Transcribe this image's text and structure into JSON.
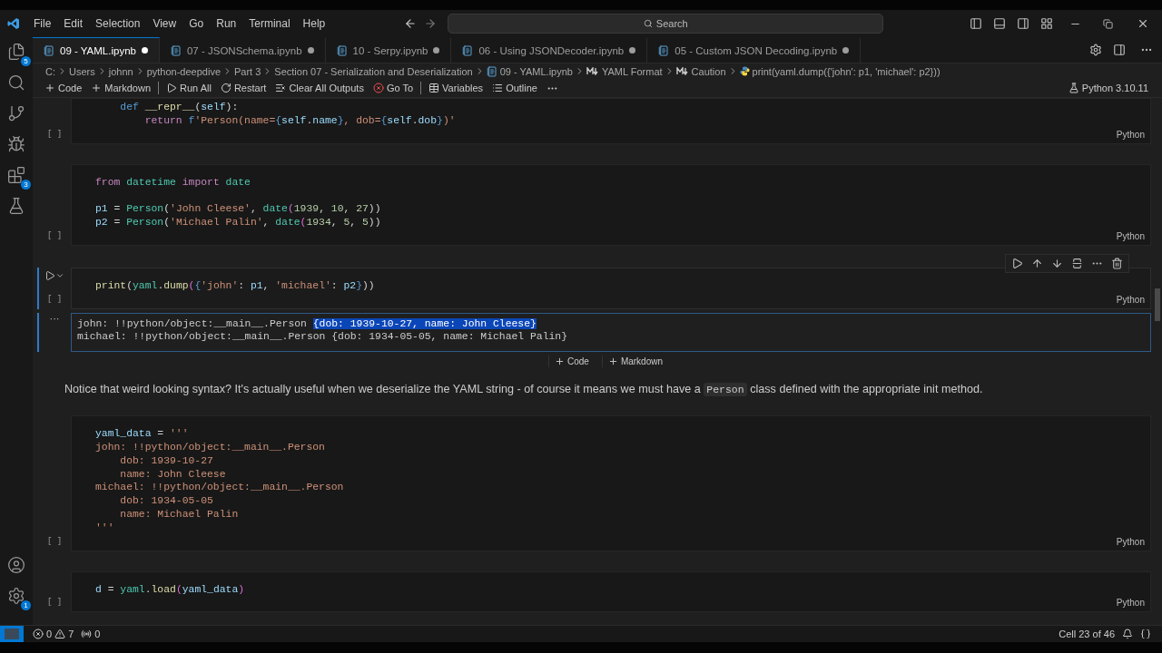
{
  "menu": [
    "File",
    "Edit",
    "Selection",
    "View",
    "Go",
    "Run",
    "Terminal",
    "Help"
  ],
  "search": {
    "placeholder": "Search"
  },
  "activity_bar": [
    {
      "kind": "files",
      "badge": "5",
      "selected": false
    },
    {
      "kind": "search",
      "selected": false
    },
    {
      "kind": "source-control",
      "selected": false
    },
    {
      "kind": "run-debug",
      "selected": false
    },
    {
      "kind": "extensions",
      "badge": "3",
      "selected": false
    },
    {
      "kind": "testing",
      "selected": false
    }
  ],
  "activity_bar_bottom": [
    {
      "kind": "account"
    },
    {
      "kind": "settings",
      "badge": "1"
    }
  ],
  "tabs": [
    {
      "label": "09 - YAML.ipynb",
      "selected": true,
      "dirty": true
    },
    {
      "label": "07 - JSONSchema.ipynb",
      "selected": false,
      "dirty": true
    },
    {
      "label": "10 - Serpy.ipynb",
      "selected": false,
      "dirty": true
    },
    {
      "label": "06 - Using JSONDecoder.ipynb",
      "selected": false,
      "dirty": true
    },
    {
      "label": "05 - Custom JSON Decoding.ipynb",
      "selected": false,
      "dirty": true
    }
  ],
  "breadcrumb": [
    {
      "kind": "folder",
      "label": "C:"
    },
    {
      "kind": "folder",
      "label": "Users"
    },
    {
      "kind": "folder",
      "label": "johnn"
    },
    {
      "kind": "folder",
      "label": "python-deepdive"
    },
    {
      "kind": "folder",
      "label": "Part 3"
    },
    {
      "kind": "folder",
      "label": "Section 07 - Serialization and Deserialization"
    },
    {
      "kind": "notebook",
      "label": "09 - YAML.ipynb"
    },
    {
      "kind": "markdown",
      "label": "YAML Format"
    },
    {
      "kind": "markdown",
      "label": "Caution"
    },
    {
      "kind": "code",
      "label": "print(yaml.dump({'john': p1, 'michael': p2}))"
    }
  ],
  "toolbar": [
    {
      "kind": "add",
      "label": "Code"
    },
    {
      "kind": "add",
      "label": "Markdown"
    },
    {
      "kind": "separator"
    },
    {
      "kind": "run-all",
      "label": "Run All"
    },
    {
      "kind": "restart",
      "label": "Restart"
    },
    {
      "kind": "clear",
      "label": "Clear All Outputs"
    },
    {
      "kind": "goto",
      "label": "Go To"
    },
    {
      "kind": "separator"
    },
    {
      "kind": "variables",
      "label": "Variables"
    },
    {
      "kind": "outline",
      "label": "Outline"
    },
    {
      "kind": "more"
    }
  ],
  "kernel": "Python 3.10.11",
  "cells": [
    {
      "kind": "code",
      "selected": false,
      "exec": "[ ]",
      "language": "Python",
      "lines": [
        {
          "tokens": [
            {
              "text": "    def ",
              "kind": "kw"
            },
            {
              "text": "__repr__",
              "kind": "fn"
            },
            {
              "text": "(",
              "kind": "p"
            },
            {
              "text": "self",
              "kind": "var"
            },
            {
              "text": "):",
              "kind": "p"
            }
          ]
        },
        {
          "tokens": [
            {
              "text": "        return ",
              "kind": "ctl"
            },
            {
              "text": "f",
              "kind": "kw"
            },
            {
              "text": "'Person(name=",
              "kind": "str"
            },
            {
              "text": "{",
              "kind": "kw"
            },
            {
              "text": "self",
              "kind": "var"
            },
            {
              "text": ".",
              "kind": "p"
            },
            {
              "text": "name",
              "kind": "var"
            },
            {
              "text": "}",
              "kind": "kw"
            },
            {
              "text": ", dob=",
              "kind": "str"
            },
            {
              "text": "{",
              "kind": "kw"
            },
            {
              "text": "self",
              "kind": "var"
            },
            {
              "text": ".",
              "kind": "p"
            },
            {
              "text": "dob",
              "kind": "var"
            },
            {
              "text": "}",
              "kind": "kw"
            },
            {
              "text": ")'",
              "kind": "str"
            }
          ]
        }
      ]
    },
    {
      "kind": "code",
      "selected": false,
      "exec": "[ ]",
      "language": "Python",
      "lines": [
        {
          "tokens": [
            {
              "text": "from ",
              "kind": "ctl"
            },
            {
              "text": "datetime ",
              "kind": "cls"
            },
            {
              "text": "import ",
              "kind": "ctl"
            },
            {
              "text": "date",
              "kind": "cls"
            }
          ]
        },
        {
          "blank_before": true,
          "tokens": [
            {
              "text": "p1 ",
              "kind": "var"
            },
            {
              "text": "= ",
              "kind": "p"
            },
            {
              "text": "Person",
              "kind": "cls"
            },
            {
              "text": "(",
              "kind": "p"
            },
            {
              "text": "'John Cleese'",
              "kind": "str"
            },
            {
              "text": ", ",
              "kind": "p"
            },
            {
              "text": "date",
              "kind": "cls"
            },
            {
              "text": "(",
              "kind": "br"
            },
            {
              "text": "1939",
              "kind": "num"
            },
            {
              "text": ", ",
              "kind": "p"
            },
            {
              "text": "10",
              "kind": "num"
            },
            {
              "text": ", ",
              "kind": "p"
            },
            {
              "text": "27",
              "kind": "num"
            },
            {
              "text": "))",
              "kind": "p"
            }
          ]
        },
        {
          "tokens": [
            {
              "text": "p2 ",
              "kind": "var"
            },
            {
              "text": "= ",
              "kind": "p"
            },
            {
              "text": "Person",
              "kind": "cls"
            },
            {
              "text": "(",
              "kind": "p"
            },
            {
              "text": "'Michael Palin'",
              "kind": "str"
            },
            {
              "text": ", ",
              "kind": "p"
            },
            {
              "text": "date",
              "kind": "cls"
            },
            {
              "text": "(",
              "kind": "br"
            },
            {
              "text": "1934",
              "kind": "num"
            },
            {
              "text": ", ",
              "kind": "p"
            },
            {
              "text": "5",
              "kind": "num"
            },
            {
              "text": ", ",
              "kind": "p"
            },
            {
              "text": "5",
              "kind": "num"
            },
            {
              "text": "))",
              "kind": "p"
            }
          ]
        }
      ]
    },
    {
      "kind": "code",
      "selected": true,
      "exec": "[ ]",
      "language": "Python",
      "lines": [
        {
          "tokens": [
            {
              "text": "print",
              "kind": "fn"
            },
            {
              "text": "(",
              "kind": "p"
            },
            {
              "text": "yaml",
              "kind": "cls"
            },
            {
              "text": ".",
              "kind": "p"
            },
            {
              "text": "dump",
              "kind": "fn"
            },
            {
              "text": "(",
              "kind": "br"
            },
            {
              "text": "{",
              "kind": "kw"
            },
            {
              "text": "'john'",
              "kind": "str"
            },
            {
              "text": ": ",
              "kind": "p"
            },
            {
              "text": "p1",
              "kind": "var"
            },
            {
              "text": ", ",
              "kind": "p"
            },
            {
              "text": "'michael'",
              "kind": "str"
            },
            {
              "text": ": ",
              "kind": "p"
            },
            {
              "text": "p2",
              "kind": "var"
            },
            {
              "text": "}",
              "kind": "kw"
            },
            {
              "text": "))",
              "kind": "p"
            }
          ]
        }
      ],
      "output": {
        "marker": "···",
        "lines": [
          [
            {
              "text": "john: !!python/object:__main__.Person ",
              "selected": false
            },
            {
              "text": "{dob: 1939-10-27, name: John Cleese}",
              "selected": true
            }
          ],
          [
            {
              "text": "michael: !!python/object:__main__.Person {dob: 1934-05-05, name: Michael Palin}",
              "selected": false
            }
          ]
        ]
      }
    },
    {
      "kind": "insert",
      "buttons": [
        "Code",
        "Markdown"
      ]
    },
    {
      "kind": "markdown",
      "segments": [
        {
          "kind": "text",
          "text": "Notice that weird looking syntax? It's actually useful when we deserialize the YAML string - of course it means we must have a "
        },
        {
          "kind": "code",
          "text": "Person"
        },
        {
          "kind": "text",
          "text": " class defined with the appropriate init method."
        }
      ]
    },
    {
      "kind": "code",
      "selected": false,
      "exec": "[ ]",
      "language": "Python",
      "lines": [
        {
          "tokens": [
            {
              "text": "yaml_data ",
              "kind": "var"
            },
            {
              "text": "= ",
              "kind": "p"
            },
            {
              "text": "'''",
              "kind": "str"
            }
          ]
        },
        {
          "tokens": [
            {
              "text": "john: !!python/object:__main__.Person",
              "kind": "str"
            }
          ]
        },
        {
          "tokens": [
            {
              "text": "    dob: 1939-10-27",
              "kind": "str"
            }
          ]
        },
        {
          "tokens": [
            {
              "text": "    name: John Cleese",
              "kind": "str"
            }
          ]
        },
        {
          "tokens": [
            {
              "text": "michael: !!python/object:__main__.Person",
              "kind": "str"
            }
          ]
        },
        {
          "tokens": [
            {
              "text": "    dob: 1934-05-05",
              "kind": "str"
            }
          ]
        },
        {
          "tokens": [
            {
              "text": "    name: Michael Palin",
              "kind": "str"
            }
          ]
        },
        {
          "tokens": [
            {
              "text": "'''",
              "kind": "str"
            }
          ]
        }
      ]
    },
    {
      "kind": "code",
      "selected": false,
      "exec": "[ ]",
      "language": "Python",
      "lines": [
        {
          "tokens": [
            {
              "text": "d ",
              "kind": "var"
            },
            {
              "text": "= ",
              "kind": "p"
            },
            {
              "text": "yaml",
              "kind": "cls"
            },
            {
              "text": ".",
              "kind": "p"
            },
            {
              "text": "load",
              "kind": "fn"
            },
            {
              "text": "(",
              "kind": "br"
            },
            {
              "text": "yaml_data",
              "kind": "var"
            },
            {
              "text": ")",
              "kind": "br"
            }
          ]
        }
      ]
    }
  ],
  "status_bar": {
    "errors": "0",
    "warnings": "7",
    "ports": "0",
    "cell_position": "Cell 23 of 46"
  }
}
